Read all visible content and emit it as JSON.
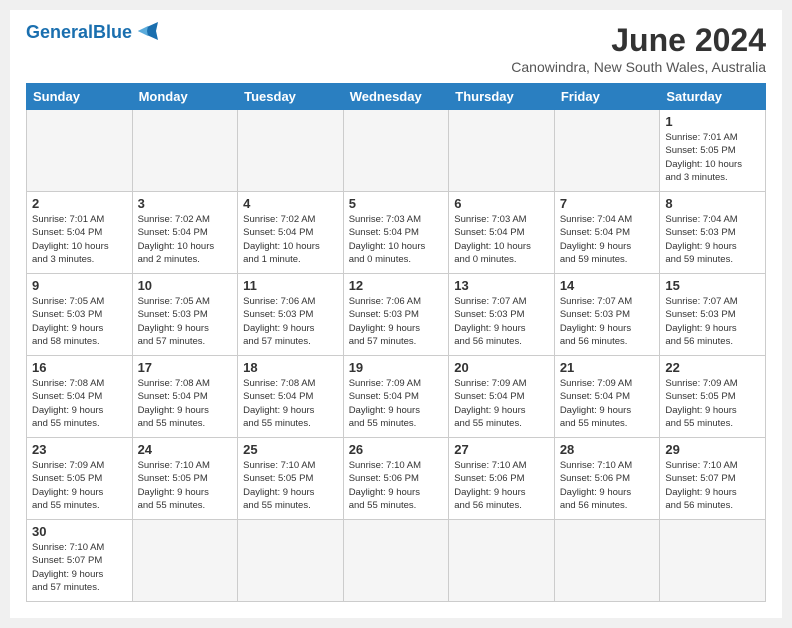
{
  "header": {
    "logo_general": "General",
    "logo_blue": "Blue",
    "month_title": "June 2024",
    "location": "Canowindra, New South Wales, Australia"
  },
  "days_of_week": [
    "Sunday",
    "Monday",
    "Tuesday",
    "Wednesday",
    "Thursday",
    "Friday",
    "Saturday"
  ],
  "weeks": [
    [
      {
        "day": "",
        "info": ""
      },
      {
        "day": "",
        "info": ""
      },
      {
        "day": "",
        "info": ""
      },
      {
        "day": "",
        "info": ""
      },
      {
        "day": "",
        "info": ""
      },
      {
        "day": "",
        "info": ""
      },
      {
        "day": "1",
        "info": "Sunrise: 7:01 AM\nSunset: 5:05 PM\nDaylight: 10 hours\nand 3 minutes."
      }
    ],
    [
      {
        "day": "2",
        "info": "Sunrise: 7:01 AM\nSunset: 5:04 PM\nDaylight: 10 hours\nand 3 minutes."
      },
      {
        "day": "3",
        "info": "Sunrise: 7:02 AM\nSunset: 5:04 PM\nDaylight: 10 hours\nand 2 minutes."
      },
      {
        "day": "4",
        "info": "Sunrise: 7:02 AM\nSunset: 5:04 PM\nDaylight: 10 hours\nand 1 minute."
      },
      {
        "day": "5",
        "info": "Sunrise: 7:03 AM\nSunset: 5:04 PM\nDaylight: 10 hours\nand 0 minutes."
      },
      {
        "day": "6",
        "info": "Sunrise: 7:03 AM\nSunset: 5:04 PM\nDaylight: 10 hours\nand 0 minutes."
      },
      {
        "day": "7",
        "info": "Sunrise: 7:04 AM\nSunset: 5:04 PM\nDaylight: 9 hours\nand 59 minutes."
      },
      {
        "day": "8",
        "info": "Sunrise: 7:04 AM\nSunset: 5:03 PM\nDaylight: 9 hours\nand 59 minutes."
      }
    ],
    [
      {
        "day": "9",
        "info": "Sunrise: 7:05 AM\nSunset: 5:03 PM\nDaylight: 9 hours\nand 58 minutes."
      },
      {
        "day": "10",
        "info": "Sunrise: 7:05 AM\nSunset: 5:03 PM\nDaylight: 9 hours\nand 57 minutes."
      },
      {
        "day": "11",
        "info": "Sunrise: 7:06 AM\nSunset: 5:03 PM\nDaylight: 9 hours\nand 57 minutes."
      },
      {
        "day": "12",
        "info": "Sunrise: 7:06 AM\nSunset: 5:03 PM\nDaylight: 9 hours\nand 57 minutes."
      },
      {
        "day": "13",
        "info": "Sunrise: 7:07 AM\nSunset: 5:03 PM\nDaylight: 9 hours\nand 56 minutes."
      },
      {
        "day": "14",
        "info": "Sunrise: 7:07 AM\nSunset: 5:03 PM\nDaylight: 9 hours\nand 56 minutes."
      },
      {
        "day": "15",
        "info": "Sunrise: 7:07 AM\nSunset: 5:03 PM\nDaylight: 9 hours\nand 56 minutes."
      }
    ],
    [
      {
        "day": "16",
        "info": "Sunrise: 7:08 AM\nSunset: 5:04 PM\nDaylight: 9 hours\nand 55 minutes."
      },
      {
        "day": "17",
        "info": "Sunrise: 7:08 AM\nSunset: 5:04 PM\nDaylight: 9 hours\nand 55 minutes."
      },
      {
        "day": "18",
        "info": "Sunrise: 7:08 AM\nSunset: 5:04 PM\nDaylight: 9 hours\nand 55 minutes."
      },
      {
        "day": "19",
        "info": "Sunrise: 7:09 AM\nSunset: 5:04 PM\nDaylight: 9 hours\nand 55 minutes."
      },
      {
        "day": "20",
        "info": "Sunrise: 7:09 AM\nSunset: 5:04 PM\nDaylight: 9 hours\nand 55 minutes."
      },
      {
        "day": "21",
        "info": "Sunrise: 7:09 AM\nSunset: 5:04 PM\nDaylight: 9 hours\nand 55 minutes."
      },
      {
        "day": "22",
        "info": "Sunrise: 7:09 AM\nSunset: 5:05 PM\nDaylight: 9 hours\nand 55 minutes."
      }
    ],
    [
      {
        "day": "23",
        "info": "Sunrise: 7:09 AM\nSunset: 5:05 PM\nDaylight: 9 hours\nand 55 minutes."
      },
      {
        "day": "24",
        "info": "Sunrise: 7:10 AM\nSunset: 5:05 PM\nDaylight: 9 hours\nand 55 minutes."
      },
      {
        "day": "25",
        "info": "Sunrise: 7:10 AM\nSunset: 5:05 PM\nDaylight: 9 hours\nand 55 minutes."
      },
      {
        "day": "26",
        "info": "Sunrise: 7:10 AM\nSunset: 5:06 PM\nDaylight: 9 hours\nand 55 minutes."
      },
      {
        "day": "27",
        "info": "Sunrise: 7:10 AM\nSunset: 5:06 PM\nDaylight: 9 hours\nand 56 minutes."
      },
      {
        "day": "28",
        "info": "Sunrise: 7:10 AM\nSunset: 5:06 PM\nDaylight: 9 hours\nand 56 minutes."
      },
      {
        "day": "29",
        "info": "Sunrise: 7:10 AM\nSunset: 5:07 PM\nDaylight: 9 hours\nand 56 minutes."
      }
    ],
    [
      {
        "day": "30",
        "info": "Sunrise: 7:10 AM\nSunset: 5:07 PM\nDaylight: 9 hours\nand 57 minutes."
      },
      {
        "day": "",
        "info": ""
      },
      {
        "day": "",
        "info": ""
      },
      {
        "day": "",
        "info": ""
      },
      {
        "day": "",
        "info": ""
      },
      {
        "day": "",
        "info": ""
      },
      {
        "day": "",
        "info": ""
      }
    ]
  ]
}
